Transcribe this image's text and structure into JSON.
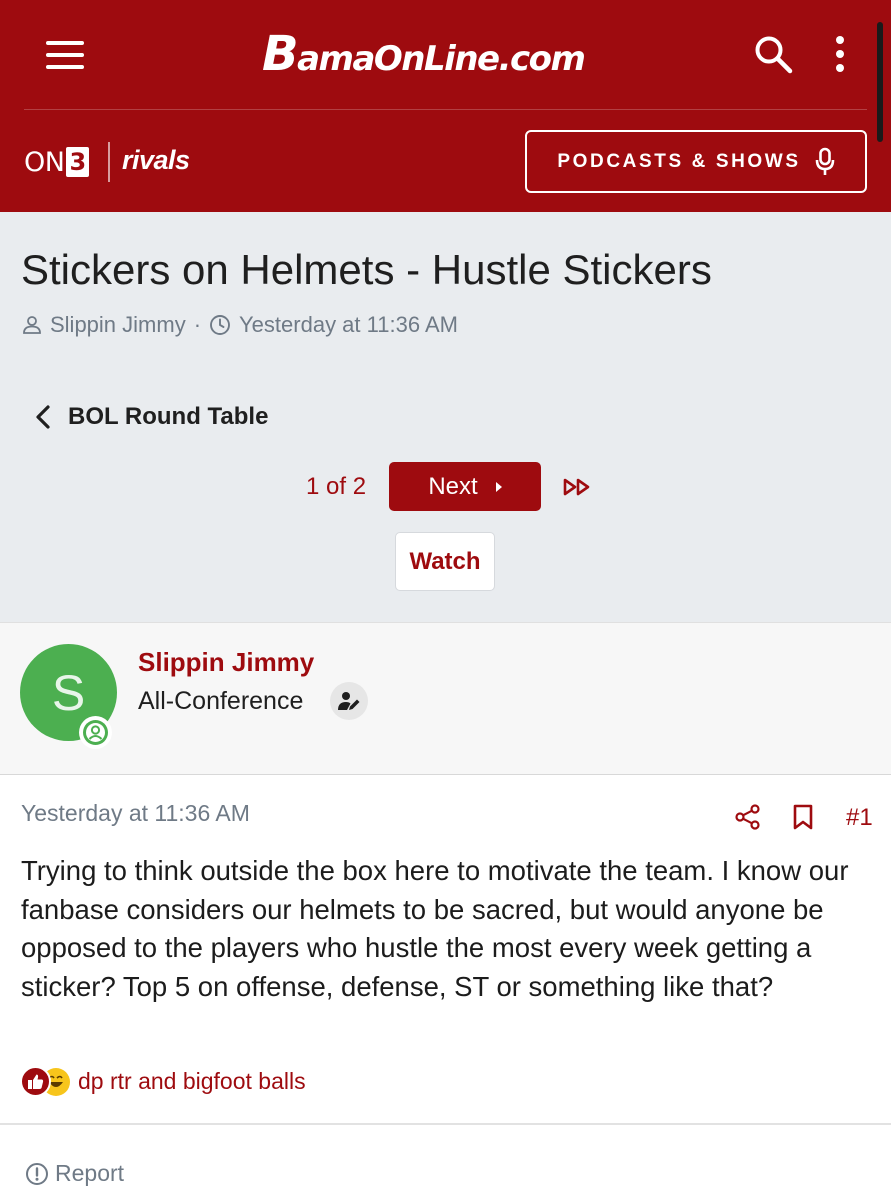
{
  "header": {
    "logo_text": "BamaOnLine.com",
    "network_brand": "ON3",
    "partner_brand": "rivals",
    "podcasts_label": "PODCASTS & SHOWS"
  },
  "thread": {
    "title": "Stickers on Helmets - Hustle Stickers",
    "author": "Slippin Jimmy",
    "meta_separator": "·",
    "posted": "Yesterday at 11:36 AM",
    "forum": "BOL Round Table"
  },
  "pagination": {
    "current": "1 of 2",
    "next_label": "Next"
  },
  "watch_label": "Watch",
  "post": {
    "avatar_letter": "S",
    "author": "Slippin Jimmy",
    "rank": "All-Conference",
    "date": "Yesterday at 11:36 AM",
    "number": "#1",
    "body": "Trying to think outside the box here to motivate the team. I know our fanbase considers our helmets to be sacred, but would anyone be opposed to the players who hustle the most every week getting a sticker? Top 5 on offense, defense, ST or something like that?",
    "reactions": {
      "types": [
        "like-icon",
        "laugh-icon"
      ],
      "summary": "dp rtr and bigfoot balls"
    },
    "report_label": "Report"
  },
  "colors": {
    "brand": "#9e0b0f",
    "page_bg": "#e9ecef",
    "muted_text": "#6f7a86",
    "avatar_green": "#4caf50"
  }
}
